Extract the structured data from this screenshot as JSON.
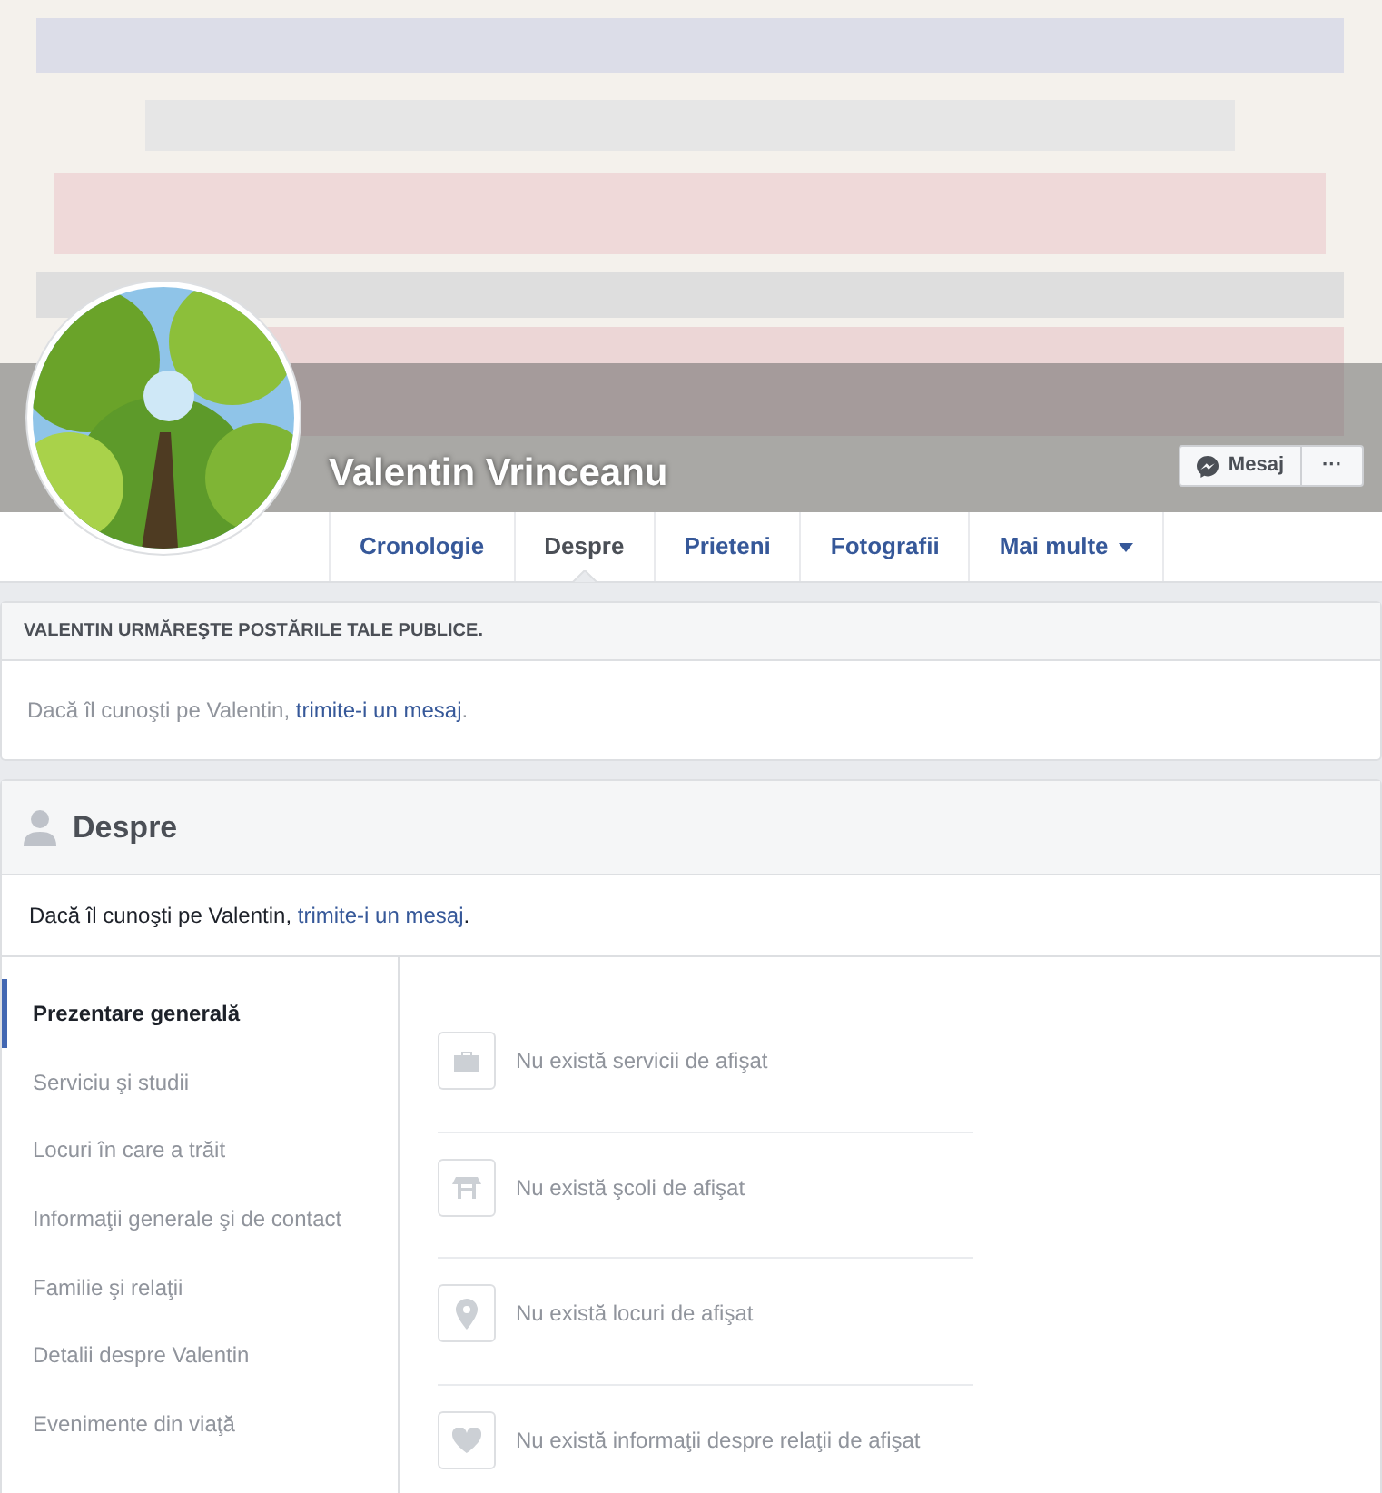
{
  "profile": {
    "name": "Valentin Vrinceanu"
  },
  "actions": {
    "message_button": "Mesaj",
    "more_button": "···"
  },
  "tabs": [
    {
      "label": "Cronologie",
      "selected": false,
      "dropdown": false
    },
    {
      "label": "Despre",
      "selected": true,
      "dropdown": false
    },
    {
      "label": "Prieteni",
      "selected": false,
      "dropdown": false
    },
    {
      "label": "Fotografii",
      "selected": false,
      "dropdown": false
    },
    {
      "label": "Mai multe",
      "selected": false,
      "dropdown": true
    }
  ],
  "follow_card": {
    "header": "VALENTIN URMĂREŞTE POSTĂRILE TALE PUBLICE.",
    "text_before": "Dacă îl cunoşti pe Valentin, ",
    "link": "trimite-i un mesaj",
    "text_after": "."
  },
  "about": {
    "title": "Despre",
    "text_before": "Dacă îl cunoşti pe Valentin, ",
    "link": "trimite-i un mesaj",
    "text_after": ".",
    "sidebar": [
      {
        "label": "Prezentare generală",
        "selected": true
      },
      {
        "label": "Serviciu şi studii",
        "selected": false
      },
      {
        "label": "Locuri în care a trăit",
        "selected": false
      },
      {
        "label": "Informaţii generale şi de contact",
        "selected": false
      },
      {
        "label": "Familie şi relaţii",
        "selected": false
      },
      {
        "label": "Detalii despre Valentin",
        "selected": false
      },
      {
        "label": "Evenimente din viaţă",
        "selected": false
      }
    ],
    "items": [
      {
        "kind": "work",
        "text": "Nu există servicii de afişat"
      },
      {
        "kind": "school",
        "text": "Nu există şcoli de afişat"
      },
      {
        "kind": "place",
        "text": "Nu există locuri de afişat"
      },
      {
        "kind": "relationship",
        "text": "Nu există informaţii despre relaţii de afişat"
      }
    ]
  }
}
